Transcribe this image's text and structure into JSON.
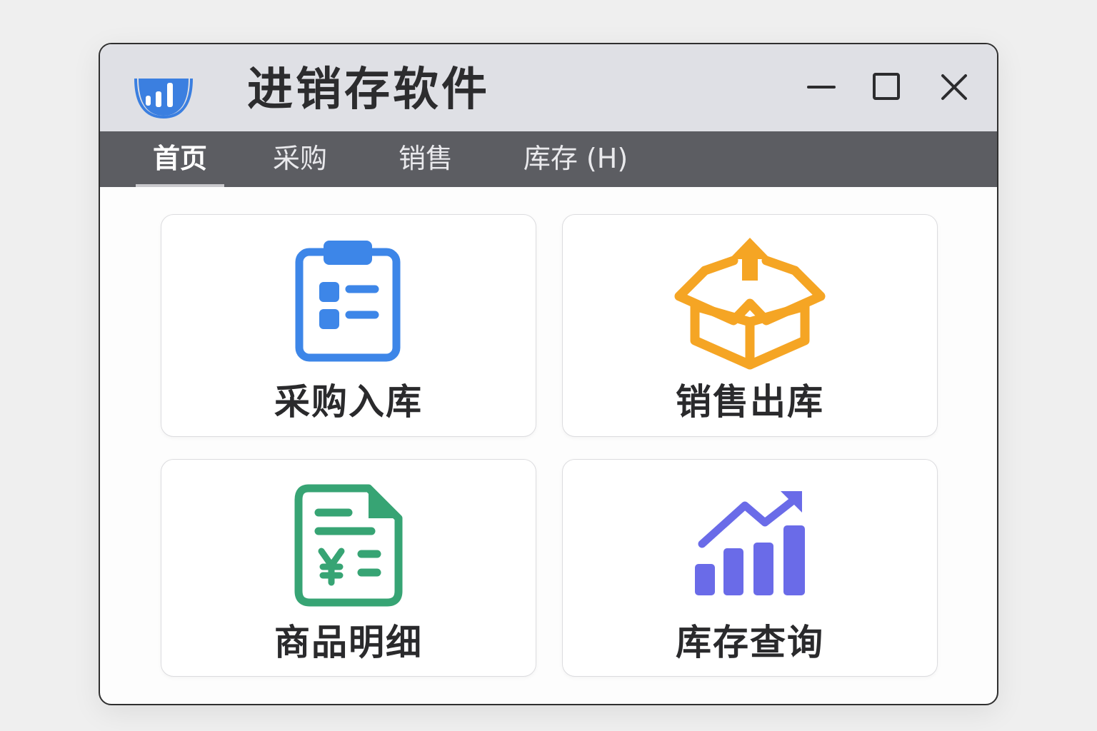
{
  "window": {
    "title": "进销存软件",
    "logo_icon": "bar-chart-logo-icon",
    "controls": {
      "minimize_icon": "minimize-icon",
      "maximize_icon": "maximize-icon",
      "close_icon": "close-icon"
    }
  },
  "menu": {
    "tabs": [
      {
        "label": "首页",
        "active": true
      },
      {
        "label": "采购",
        "active": false
      },
      {
        "label": "销售",
        "active": false
      },
      {
        "label": "库存 (H)",
        "active": false
      }
    ]
  },
  "cards": [
    {
      "label": "采购入库",
      "icon": "clipboard-list-icon",
      "color": "#3d86e8"
    },
    {
      "label": "销售出库",
      "icon": "box-upload-icon",
      "color": "#f5a524"
    },
    {
      "label": "商品明细",
      "icon": "invoice-yen-icon",
      "color": "#37a474"
    },
    {
      "label": "库存查询",
      "icon": "trend-bar-chart-icon",
      "color": "#6a6be8"
    }
  ],
  "colors": {
    "titlebar_bg": "#dfe0e5",
    "menubar_bg": "#5c5d62",
    "logo_blue": "#3b7fe0"
  }
}
